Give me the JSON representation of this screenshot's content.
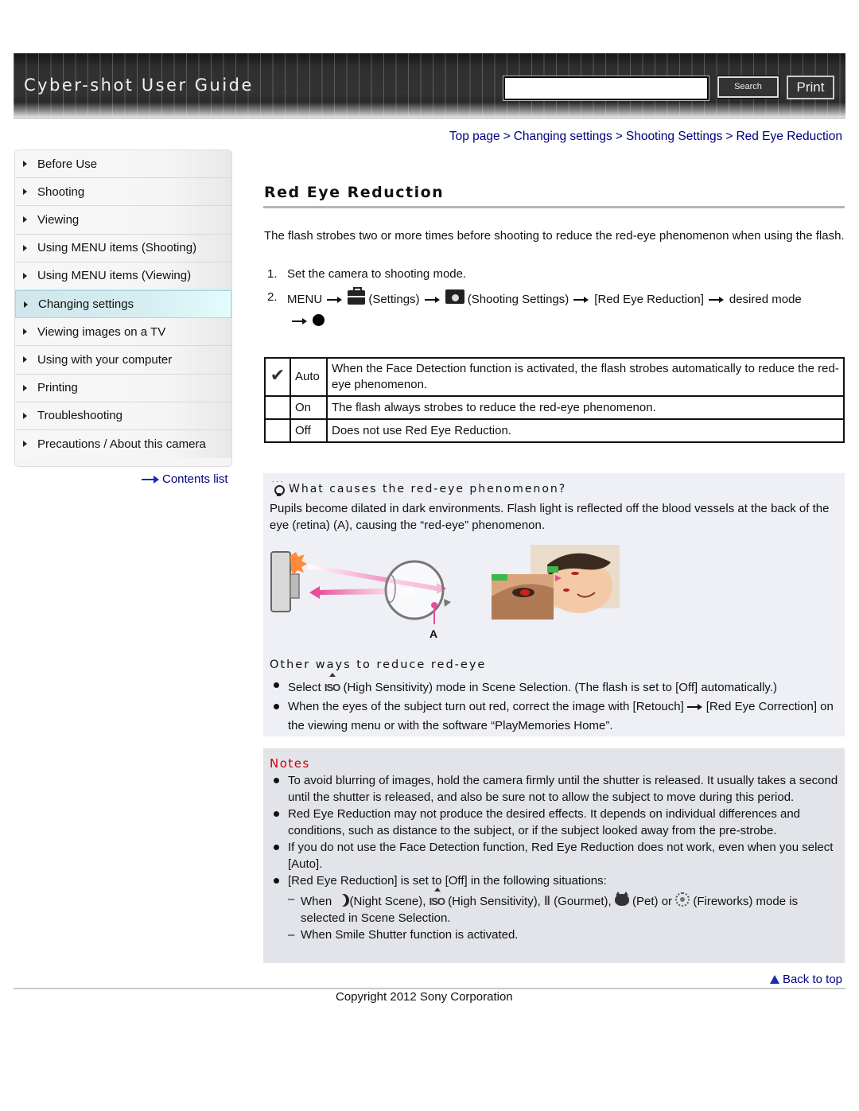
{
  "header": {
    "title": "Cyber-shot User Guide",
    "search_value": "",
    "search_button": "Search",
    "print_button": "Print"
  },
  "breadcrumb": {
    "items": [
      "Top page",
      "Changing settings",
      "Shooting Settings",
      "Red Eye Reduction"
    ],
    "separator": ">"
  },
  "sidebar": {
    "items": [
      {
        "label": "Before Use",
        "active": false
      },
      {
        "label": "Shooting",
        "active": false
      },
      {
        "label": "Viewing",
        "active": false
      },
      {
        "label": "Using MENU items (Shooting)",
        "active": false
      },
      {
        "label": "Using MENU items (Viewing)",
        "active": false
      },
      {
        "label": "Changing settings",
        "active": true
      },
      {
        "label": "Viewing images on a TV",
        "active": false
      },
      {
        "label": "Using with your computer",
        "active": false
      },
      {
        "label": "Printing",
        "active": false
      },
      {
        "label": "Troubleshooting",
        "active": false
      },
      {
        "label": "Precautions / About this camera",
        "active": false
      }
    ],
    "contents_link": "Contents list",
    "active_color": "#d6eef1"
  },
  "main": {
    "title": "Red Eye Reduction",
    "intro": "The flash strobes two or more times before shooting to reduce the red-eye phenomenon when using the flash.",
    "steps": {
      "s1_num": "1.",
      "s1_text": "Set the camera to shooting mode.",
      "s2_num": "2.",
      "s2_menu": "MENU",
      "s2_settings": "(Settings)",
      "s2_shooting_settings": "(Shooting Settings)",
      "s2_item": "[Red Eye Reduction]",
      "s2_desired": "desired mode"
    },
    "modes": [
      {
        "mode": "Auto",
        "default": true,
        "description": "When the Face Detection function is activated, the flash strobes automatically to reduce the red-eye phenomenon."
      },
      {
        "mode": "On",
        "default": false,
        "description": "The flash always strobes to reduce the red-eye phenomenon."
      },
      {
        "mode": "Off",
        "default": false,
        "description": "Does not use Red Eye Reduction."
      }
    ],
    "hint": {
      "title": "What causes the red-eye phenomenon?",
      "text": "Pupils become dilated in dark environments. Flash light is reflected off the blood vessels at the back of the eye (retina) (A), causing the “red-eye” phenomenon.",
      "diagram_label": "A",
      "other_title": "Other ways to reduce red-eye",
      "other_1_pre": "Select",
      "other_1_post": "(High Sensitivity) mode in Scene Selection. (The flash is set to [Off] automatically.)",
      "other_2_pre": "When the eyes of the subject turn out red, correct the image with [Retouch]",
      "other_2_post": "[Red Eye Correction] on the viewing menu or with the software “PlayMemories Home”."
    },
    "notes": {
      "title": "Notes",
      "items": [
        "To avoid blurring of images, hold the camera firmly until the shutter is released. It usually takes a second until the shutter is released, and also be sure not to allow the subject to move during this period.",
        "Red Eye Reduction may not produce the desired effects. It depends on individual differences and conditions, such as distance to the subject, or if the subject looked away from the pre-strobe.",
        "If you do not use the Face Detection function, Red Eye Reduction does not work, even when you select [Auto].",
        "[Red Eye Reduction] is set to [Off] in the following situations:"
      ],
      "sub_1": {
        "when": "When",
        "night": "(Night Scene),",
        "high": "(High Sensitivity),",
        "gourmet": "(Gourmet),",
        "pet": "(Pet) or",
        "fireworks": "(Fireworks) mode is selected in Scene Selection."
      },
      "sub_2": "When Smile Shutter function is activated.",
      "title_color": "#cc0000"
    }
  },
  "footer": {
    "back_to_top": "Back to top",
    "copyright": "Copyright 2012 Sony Corporation"
  },
  "colors": {
    "link": "#000080",
    "hint_bg": "#eef0f5",
    "notes_bg": "#e2e4e9"
  }
}
